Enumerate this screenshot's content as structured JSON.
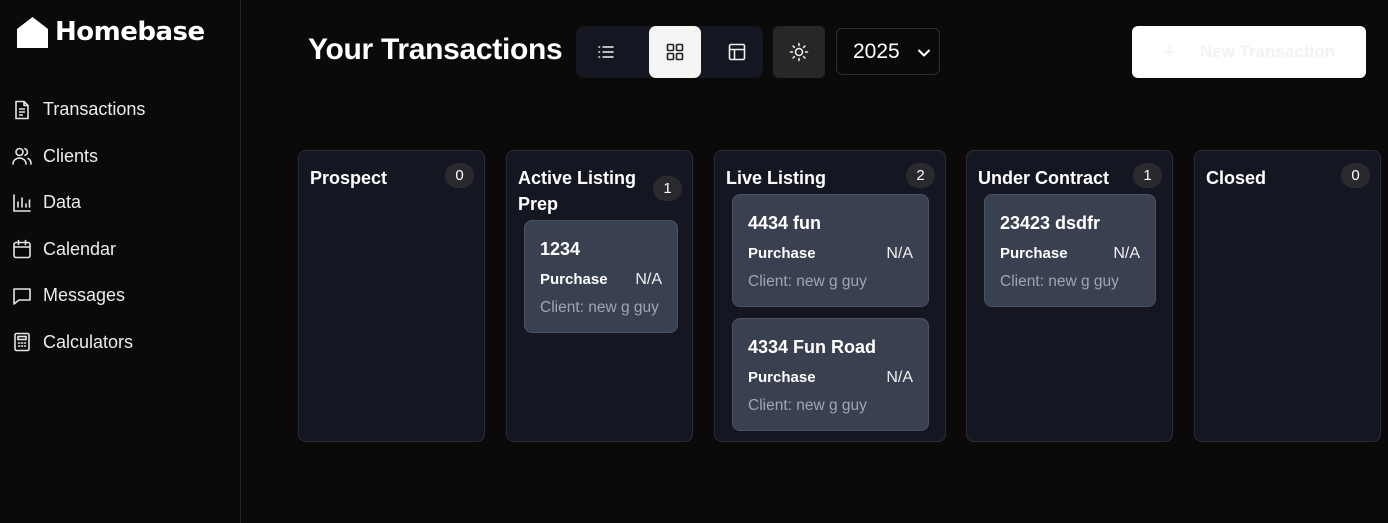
{
  "app": {
    "name": "Homebase"
  },
  "sidebar": {
    "items": [
      {
        "label": "Transactions",
        "icon": "document-icon"
      },
      {
        "label": "Clients",
        "icon": "users-icon"
      },
      {
        "label": "Data",
        "icon": "bar-chart-icon"
      },
      {
        "label": "Calendar",
        "icon": "calendar-icon"
      },
      {
        "label": "Messages",
        "icon": "message-icon"
      },
      {
        "label": "Calculators",
        "icon": "calculator-icon"
      }
    ]
  },
  "header": {
    "title": "Your Transactions",
    "views": [
      "list-view",
      "board-view",
      "table-view"
    ],
    "active_view": "board-view",
    "year": "2025",
    "new_button": {
      "icon": "+",
      "label": "New Transaction"
    }
  },
  "board": {
    "columns": [
      {
        "title": "Prospect",
        "count": "0",
        "cards": []
      },
      {
        "title": "Active Listing Prep",
        "title_line1": "Active Listing",
        "title_line2": "Prep",
        "count": "1",
        "cards": [
          {
            "title": "1234",
            "type": "Purchase",
            "price": "N/A",
            "client": "Client: new g guy"
          }
        ]
      },
      {
        "title": "Live Listing",
        "count": "2",
        "cards": [
          {
            "title": "4434 fun",
            "type": "Purchase",
            "price": "N/A",
            "client": "Client: new g guy"
          },
          {
            "title": "4334 Fun Road",
            "type": "Purchase",
            "price": "N/A",
            "client": "Client: new g guy"
          }
        ]
      },
      {
        "title": "Under Contract",
        "count": "1",
        "cards": [
          {
            "title": "23423 dsdfr",
            "type": "Purchase",
            "price": "N/A",
            "client": "Client: new g guy"
          }
        ]
      },
      {
        "title": "Closed",
        "count": "0",
        "cards": []
      }
    ]
  },
  "colors": {
    "background": "#0b0a09",
    "column": "#141722",
    "card": "#394050",
    "badge": "#2a2a2e"
  }
}
